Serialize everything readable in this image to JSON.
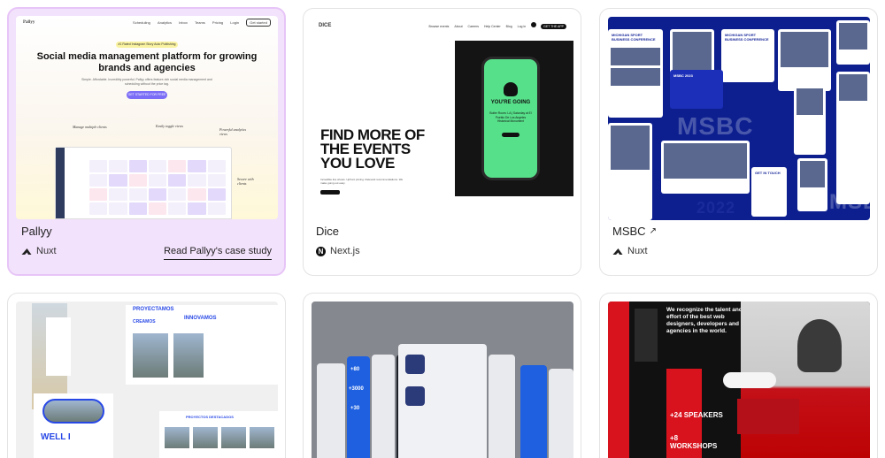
{
  "cards": [
    {
      "name": "Pallyy",
      "tech": "Nuxt",
      "tech_icon": "nuxt-icon",
      "case_study": "Read Pallyy's case study",
      "preview": {
        "brand": "Pallyy",
        "nav": [
          "Scheduling",
          "Analytics",
          "Inbox",
          "Teams",
          "Pricing",
          "Login",
          "Get started"
        ],
        "badge": "#1 Rated Instagram Story Auto Publishing",
        "headline": "Social media management platform for growing brands and agencies",
        "subtext": "Simple. Affordable. Incredibly powerful. Pallyy offers feature-rich social media management and scheduling without the price tag.",
        "cta": "GET STARTED FOR FREE",
        "notes": [
          "Manage multiple clients",
          "Easily toggle views",
          "Powerful analytics views",
          "Secure with clients"
        ]
      }
    },
    {
      "name": "Dice",
      "tech": "Next.js",
      "tech_icon": "nextjs-icon",
      "preview": {
        "brand": "DICE",
        "nav": [
          "Browse events",
          "About",
          "Careers",
          "Help Center",
          "Blog",
          "Log in",
          "GET THE APP"
        ],
        "headline": "FIND MORE OF THE EVENTS YOU LOVE",
        "phone_title": "YOU'RE GOING",
        "phone_info": "Boiler Room: LA | Saturday at El Pueblo De Los Angeles Historical Monument",
        "subtext": "Incredible live shows. Upfront pricing. Relevant recommendations. We make going out easy."
      }
    },
    {
      "name": "MSBC",
      "tech": "Nuxt",
      "tech_icon": "nuxt-icon",
      "external_icon": "external-arrow-icon",
      "preview": {
        "titles": [
          "MICHIGAN SPORT BUSINESS CONFERENCE",
          "MSBC 2023",
          "GET IN TOUCH"
        ],
        "big": [
          "MSBC",
          "MSBC",
          "2022"
        ]
      }
    },
    {
      "preview": {
        "labels": [
          "PROYECTAMOS",
          "INNOVAMOS",
          "CREAMOS",
          "WELL I",
          "PROYECTOS DESTACADOS"
        ]
      }
    },
    {
      "preview": {
        "stats": [
          "+80",
          "+3000",
          "+30"
        ]
      }
    },
    {
      "preview": {
        "lines": [
          "We recognize the talent and effort of the best web designers, developers and agencies in the world.",
          "+24 SPEAKERS",
          "+8 WORKSHOPS"
        ]
      }
    }
  ]
}
